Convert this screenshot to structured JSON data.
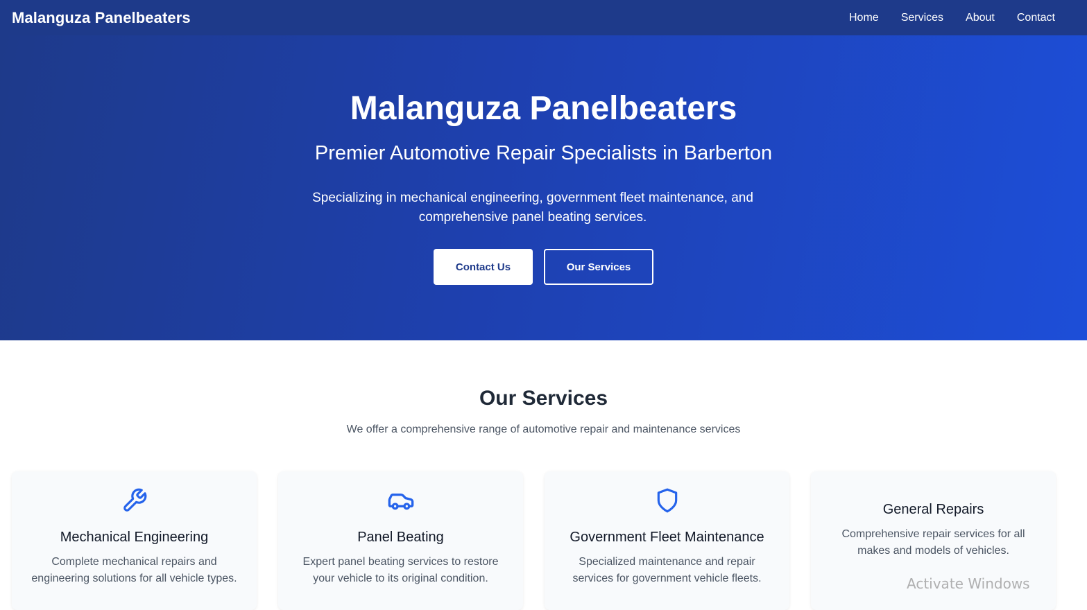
{
  "nav": {
    "brand": "Malanguza Panelbeaters",
    "links": [
      "Home",
      "Services",
      "About",
      "Contact"
    ]
  },
  "hero": {
    "title": "Malanguza Panelbeaters",
    "subtitle": "Premier Automotive Repair Specialists in Barberton",
    "description": "Specializing in mechanical engineering, government fleet maintenance, and comprehensive panel beating services.",
    "primary_button": "Contact Us",
    "secondary_button": "Our Services"
  },
  "services": {
    "title": "Our Services",
    "subtitle": "We offer a comprehensive range of automotive repair and maintenance services",
    "cards": [
      {
        "icon": "wrench-icon",
        "title": "Mechanical Engineering",
        "description": "Complete mechanical repairs and engineering solutions for all vehicle types."
      },
      {
        "icon": "car-icon",
        "title": "Panel Beating",
        "description": "Expert panel beating services to restore your vehicle to its original condition."
      },
      {
        "icon": "shield-icon",
        "title": "Government Fleet Maintenance",
        "description": "Specialized maintenance and repair services for government vehicle fleets."
      },
      {
        "icon": "",
        "title": "General Repairs",
        "description": "Comprehensive repair services for all makes and models of vehicles."
      }
    ]
  },
  "overlay": {
    "watermark": "Activate Windows"
  },
  "colors": {
    "nav_bg": "#1e3a8a",
    "hero_gradient_start": "#1e3a8a",
    "hero_gradient_end": "#1d4ed8",
    "accent_icon": "#2563eb",
    "card_bg": "#f8fafc"
  }
}
